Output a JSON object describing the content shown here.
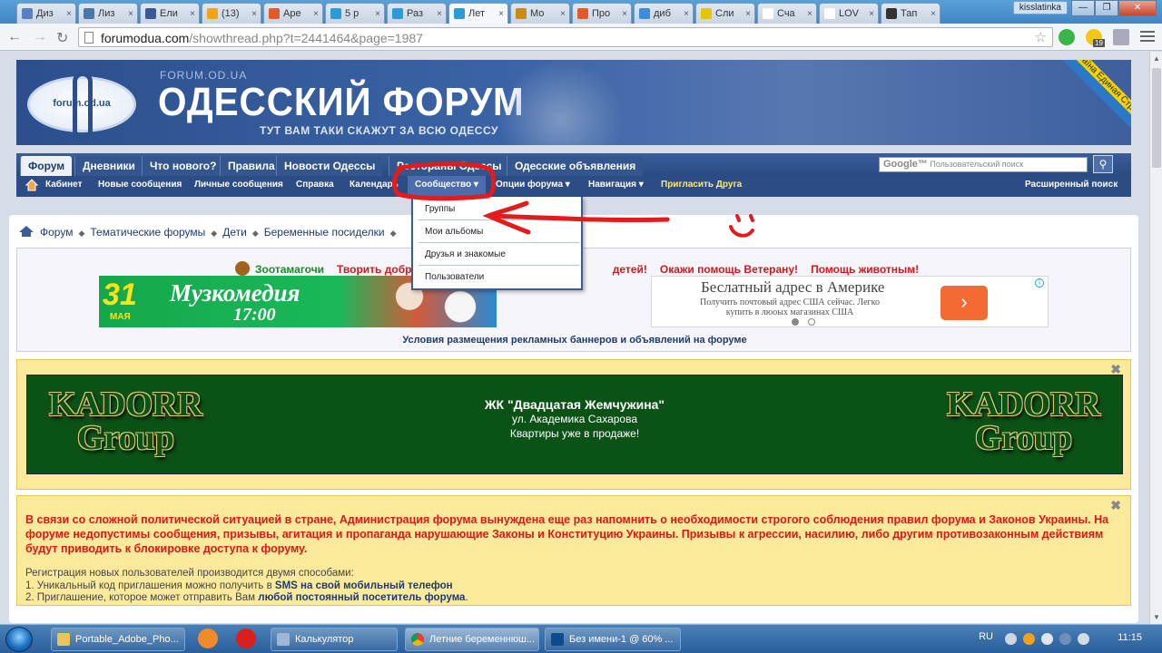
{
  "browser": {
    "tabs": [
      {
        "label": "Диз",
        "color": "#5b7fc4"
      },
      {
        "label": "Лиз",
        "color": "#4a76a8"
      },
      {
        "label": "Ели",
        "color": "#3b5998"
      },
      {
        "label": "(13)",
        "color": "#f2a31c"
      },
      {
        "label": "Аре",
        "color": "#e05a2a"
      },
      {
        "label": "5 р",
        "color": "#2d9ad8"
      },
      {
        "label": "Раз",
        "color": "#2d9ad8"
      },
      {
        "label": "Лет",
        "color": "#2d9ad8"
      },
      {
        "label": "Мо",
        "color": "#c98b1a"
      },
      {
        "label": "Про",
        "color": "#e05a2a"
      },
      {
        "label": "диб",
        "color": "#3a8ed8"
      },
      {
        "label": "Сли",
        "color": "#e8c400"
      },
      {
        "label": "Сча",
        "color": "#ffffff"
      },
      {
        "label": "LOV",
        "color": "#ffffff"
      },
      {
        "label": "Тап",
        "color": "#333333"
      }
    ],
    "user": "kisslatinka",
    "url_domain": "forumodua.com",
    "url_path": "/showthread.php?t=2441464&page=1987",
    "extension_badge": "19"
  },
  "header": {
    "site_label": "FORUM.OD.UA",
    "logo_text": "forum.od.ua",
    "title": "ОДЕССКИЙ ФОРУМ",
    "slogan": "ТУТ ВАМ ТАКИ СКАЖУТ ЗА ВСЮ ОДЕССУ",
    "ribbon": "Єдина Країна Единая Страна"
  },
  "main_nav": [
    "Форум",
    "Дневники",
    "Что нового?",
    "Правила",
    "Новости Одессы",
    "Рестораны Одессы",
    "Одесские объявления"
  ],
  "search": {
    "brand": "Google™",
    "placeholder": "Пользовательский поиск"
  },
  "sub_nav": {
    "items": [
      "Кабинет",
      "Новые сообщения",
      "Личные сообщения",
      "Справка",
      "Календарь"
    ],
    "community": "Сообщество",
    "options": "Опции форума",
    "navigation": "Навигация",
    "invite": "Пригласить Друга",
    "advanced_search": "Расширенный поиск"
  },
  "dropdown": [
    "Группы",
    "Мои альбомы",
    "Друзья и знакомые",
    "Пользователи"
  ],
  "breadcrumb": [
    "Форум",
    "Тематические форумы",
    "Дети",
    "Беременные посиделки"
  ],
  "ads": {
    "zoo": "Зоотамагочи",
    "slogans": [
      "Творить добро",
      "детей!",
      "Окажи помощь Ветерану!",
      "Помощь животным!"
    ],
    "muz": {
      "day": "31",
      "month": "МАЯ",
      "name": "Музкомедия",
      "time": "17:00"
    },
    "google_ad": {
      "headline": "Беслатный адрес в Америке",
      "desc": "Получить почтовый адрес США сейчас. Легко купить в люоых магазинах США"
    },
    "rules_link": "Условия размещения рекламных баннеров и объявлений на форуме"
  },
  "kadorr": {
    "logo": "KADORR Group",
    "title": "ЖК \"Двадцатая Жемчужина\"",
    "street": "ул. Академика Сахарова",
    "sale": "Квартиры уже в продаже!"
  },
  "notice": {
    "warning": "В связи со сложной политической ситуацией в стране, Администрация форума вынуждена еще раз напомнить о необходимости строгого соблюдения правил форума и Законов Украины. На форуме недопустимы сообщения, призывы, агитация и пропаганда нарушающие Законы и Конституцию Украины. Призывы к агрессии, насилию, либо другим противозаконным действиям будут приводить к блокировке доступа к форуму.",
    "reg_intro": "Регистрация новых пользователей производится двумя способами:",
    "reg1_prefix": "1. Уникальный код приглашения можно получить в",
    "reg1_link": "SMS на свой мобильный телефон",
    "reg2_prefix": "2. Приглашение, которое может отправить Вам",
    "reg2_link": "любой постоянный посетитель форума",
    "reg2_suffix": "."
  },
  "taskbar": {
    "items": [
      "Portable_Adobe_Pho...",
      "Калькулятор",
      "Летние беременнюш...",
      "Без имени-1 @ 60% ..."
    ],
    "lang": "RU",
    "time": "11:15"
  },
  "colors": {
    "accent": "#2c4c86",
    "annotation": "#e31b1b",
    "notice_bg": "#fcea9c"
  }
}
